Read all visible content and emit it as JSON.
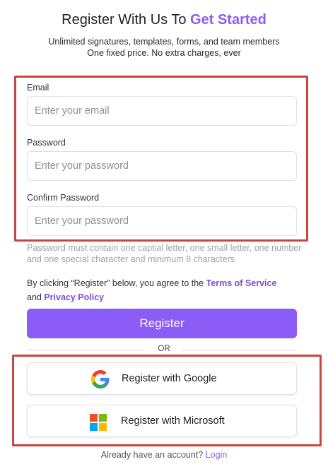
{
  "header": {
    "title_plain": "Register With Us To",
    "title_accent": "Get Started",
    "subtitle_line1": "Unlimited signatures, templates, forms, and team members",
    "subtitle_line2": "One fixed price. No extra charges, ever"
  },
  "form": {
    "email": {
      "label": "Email",
      "placeholder": "Enter your email",
      "value": ""
    },
    "password": {
      "label": "Password",
      "placeholder": "Enter your password",
      "value": ""
    },
    "confirm_password": {
      "label": "Confirm Password",
      "placeholder": "Enter your password",
      "value": ""
    },
    "password_hint": "Password must contain one captial letter, one small letter, one number and one special character and minimum 8 characters"
  },
  "agreement": {
    "prefix": "By clicking “Register” below, you agree to the",
    "terms_link": "Terms of Service",
    "conjunction": "and",
    "privacy_link": "Privacy Policy"
  },
  "actions": {
    "register_label": "Register",
    "or_label": "OR",
    "google_label": "Register with Google",
    "microsoft_label": "Register with Microsoft"
  },
  "footer": {
    "prompt": "Already have an account?",
    "login_link": "Login"
  },
  "icons": {
    "google": "google-logo-icon",
    "microsoft": "microsoft-logo-icon"
  },
  "colors": {
    "accent": "#8b5cf6",
    "link": "#7c4ddc",
    "highlight_border": "#c9453d",
    "hint_text": "#a0a0a8",
    "google_blue": "#4285F4",
    "google_red": "#EA4335",
    "google_yellow": "#FBBC05",
    "google_green": "#34A853",
    "ms_red": "#F25022",
    "ms_green": "#7FBA00",
    "ms_blue": "#00A4EF",
    "ms_yellow": "#FFB900"
  }
}
